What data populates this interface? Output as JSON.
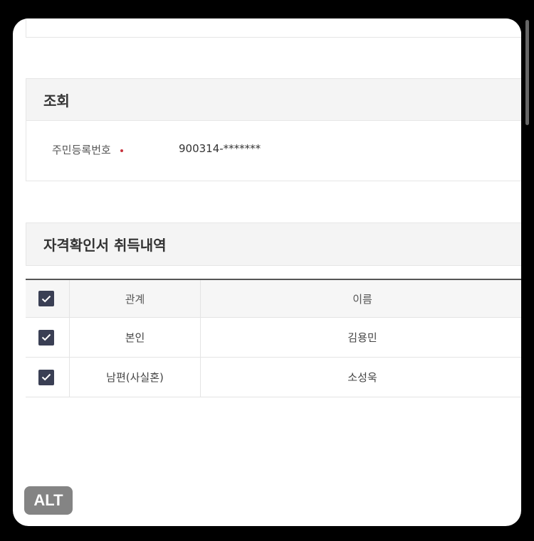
{
  "lookup": {
    "title": "조회",
    "field_label": "주민등록번호",
    "field_value": "900314-*******"
  },
  "qualification": {
    "title": "자격확인서 취득내역",
    "columns": [
      "관계",
      "이름"
    ],
    "rows": [
      {
        "relation": "본인",
        "name": "김용민",
        "checked": true
      },
      {
        "relation": "남편(사실혼)",
        "name": "소성욱",
        "checked": true
      }
    ],
    "header_checked": true
  },
  "badge": {
    "label": "ALT"
  },
  "colors": {
    "checkbox": "#3a3f54",
    "required_dot": "#c8343f",
    "header_bg": "#f4f4f4"
  }
}
